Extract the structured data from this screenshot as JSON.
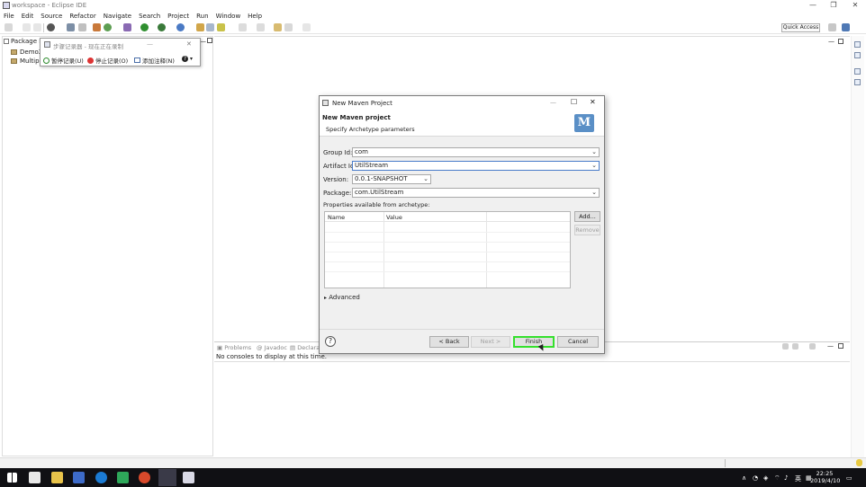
{
  "window": {
    "title": "workspace - Eclipse IDE",
    "minimize_glyph": "—",
    "restore_glyph": "❐",
    "close_glyph": "✕"
  },
  "menu": [
    "File",
    "Edit",
    "Source",
    "Refactor",
    "Navigate",
    "Search",
    "Project",
    "Run",
    "Window",
    "Help"
  ],
  "toolbar": {
    "quick_access": "Quick Access"
  },
  "left_panel": {
    "tab_label": "Package E",
    "items": [
      "Demo2",
      "Multipl"
    ]
  },
  "step_recorder": {
    "title": "步骤记录器 - 现在正在录制",
    "pause": "暂停记录(U)",
    "stop": "停止记录(O)",
    "comment": "添加注释(N)",
    "help": "?",
    "minimize_glyph": "—",
    "close_glyph": "✕"
  },
  "dialog": {
    "title": "New Maven Project",
    "heading": "New Maven project",
    "subtitle": "Specify Archetype parameters",
    "logo_letter": "M",
    "fields": {
      "group_id_label": "Group Id:",
      "group_id_value": "com",
      "artifact_id_label": "Artifact Id:",
      "artifact_id_value": "UtilStream",
      "version_label": "Version:",
      "version_value": "0.0.1-SNAPSHOT",
      "package_label": "Package:",
      "package_value": "com.UtilStream"
    },
    "properties_label": "Properties available from archetype:",
    "columns": [
      "Name",
      "Value"
    ],
    "add_button": "Add...",
    "remove_button": "Remove",
    "advanced": "Advanced",
    "help_glyph": "?",
    "back_button": "< Back",
    "next_button": "Next >",
    "finish_button": "Finish",
    "cancel_button": "Cancel",
    "minimize_glyph": "—",
    "maximize_glyph": "☐",
    "close_glyph": "✕"
  },
  "console": {
    "tabs": [
      "Problems",
      "Javadoc",
      "Declara"
    ],
    "message": "No consoles to display at this time."
  },
  "taskbar": {
    "time": "22:25",
    "date": "2019/4/10",
    "ime_lang": "英",
    "tray_up": "∧"
  },
  "colors": {
    "finish_highlight": "#35e02d",
    "taskbar_bg": "#101014",
    "maven_logo": "#5a8fc6"
  }
}
